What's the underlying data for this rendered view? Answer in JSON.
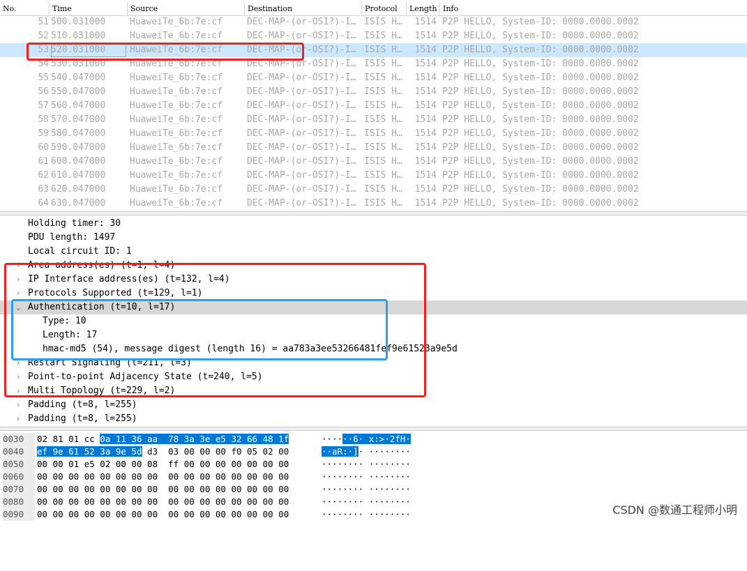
{
  "columns": {
    "no": "No.",
    "time": "Time",
    "source": "Source",
    "destination": "Destination",
    "protocol": "Protocol",
    "length": "Length",
    "info": "Info"
  },
  "packets": [
    {
      "no": "51",
      "time": "500.031000",
      "src": "HuaweiTe_6b:7e:cf",
      "dst": "DEC-MAP-(or-OSI?)-I…",
      "proto": "ISIS H…",
      "len": "1514",
      "info": "P2P HELLO, System-ID: 0000.0000.0002"
    },
    {
      "no": "52",
      "time": "510.031000",
      "src": "HuaweiTe_6b:7e:cf",
      "dst": "DEC-MAP-(or-OSI?)-I…",
      "proto": "ISIS H…",
      "len": "1514",
      "info": "P2P HELLO, System-ID: 0000.0000.0002"
    },
    {
      "no": "53",
      "time": "520.031000",
      "src": "HuaweiTe_6b:7e:cf",
      "dst": "DEC-MAP-(or-OSI?)-I…",
      "proto": "ISIS H…",
      "len": "1514",
      "info": "P2P HELLO, System-ID: 0000.0000.0002"
    },
    {
      "no": "54",
      "time": "530.031000",
      "src": "HuaweiTe_6b:7e:cf",
      "dst": "DEC-MAP-(or-OSI?)-I…",
      "proto": "ISIS H…",
      "len": "1514",
      "info": "P2P HELLO, System-ID: 0000.0000.0002"
    },
    {
      "no": "55",
      "time": "540.047000",
      "src": "HuaweiTe_6b:7e:cf",
      "dst": "DEC-MAP-(or-OSI?)-I…",
      "proto": "ISIS H…",
      "len": "1514",
      "info": "P2P HELLO, System-ID: 0000.0000.0002"
    },
    {
      "no": "56",
      "time": "550.047000",
      "src": "HuaweiTe_6b:7e:cf",
      "dst": "DEC-MAP-(or-OSI?)-I…",
      "proto": "ISIS H…",
      "len": "1514",
      "info": "P2P HELLO, System-ID: 0000.0000.0002"
    },
    {
      "no": "57",
      "time": "560.047000",
      "src": "HuaweiTe_6b:7e:cf",
      "dst": "DEC-MAP-(or-OSI?)-I…",
      "proto": "ISIS H…",
      "len": "1514",
      "info": "P2P HELLO, System-ID: 0000.0000.0002"
    },
    {
      "no": "58",
      "time": "570.047000",
      "src": "HuaweiTe_6b:7e:cf",
      "dst": "DEC-MAP-(or-OSI?)-I…",
      "proto": "ISIS H…",
      "len": "1514",
      "info": "P2P HELLO, System-ID: 0000.0000.0002"
    },
    {
      "no": "59",
      "time": "580.047000",
      "src": "HuaweiTe_6b:7e:cf",
      "dst": "DEC-MAP-(or-OSI?)-I…",
      "proto": "ISIS H…",
      "len": "1514",
      "info": "P2P HELLO, System-ID: 0000.0000.0002"
    },
    {
      "no": "60",
      "time": "590.047000",
      "src": "HuaweiTe_6b:7e:cf",
      "dst": "DEC-MAP-(or-OSI?)-I…",
      "proto": "ISIS H…",
      "len": "1514",
      "info": "P2P HELLO, System-ID: 0000.0000.0002"
    },
    {
      "no": "61",
      "time": "600.047000",
      "src": "HuaweiTe_6b:7e:cf",
      "dst": "DEC-MAP-(or-OSI?)-I…",
      "proto": "ISIS H…",
      "len": "1514",
      "info": "P2P HELLO, System-ID: 0000.0000.0002"
    },
    {
      "no": "62",
      "time": "610.047000",
      "src": "HuaweiTe_6b:7e:cf",
      "dst": "DEC-MAP-(or-OSI?)-I…",
      "proto": "ISIS H…",
      "len": "1514",
      "info": "P2P HELLO, System-ID: 0000.0000.0002"
    },
    {
      "no": "63",
      "time": "620.047000",
      "src": "HuaweiTe_6b:7e:cf",
      "dst": "DEC-MAP-(or-OSI?)-I…",
      "proto": "ISIS H…",
      "len": "1514",
      "info": "P2P HELLO, System-ID: 0000.0000.0002"
    },
    {
      "no": "64",
      "time": "630.047000",
      "src": "HuaweiTe_6b:7e:cf",
      "dst": "DEC-MAP-(or-OSI?)-I…",
      "proto": "ISIS H…",
      "len": "1514",
      "info": "P2P HELLO, System-ID: 0000.0000.0002"
    }
  ],
  "selected_packet": "53",
  "detail": {
    "holding_timer": "Holding timer: 30",
    "pdu_length": "PDU length: 1497",
    "local_circuit": "Local circuit ID: 1",
    "area_address": "Area address(es) (t=1, l=4)",
    "ip_interface": "IP Interface address(es) (t=132, l=4)",
    "protocols_supported": "Protocols Supported (t=129, l=1)",
    "authentication": "Authentication (t=10, l=17)",
    "auth_type": "Type: 10",
    "auth_length": "Length: 17",
    "auth_digest": "hmac-md5 (54), message digest (length 16) = aa783a3ee53266481fef9e61523a9e5d",
    "restart_signaling": "Restart Signaling (t=211, l=3)",
    "p2p_adjacency": "Point-to-point Adjacency State (t=240, l=5)",
    "multi_topology": "Multi Topology (t=229, l=2)",
    "padding_1": "Padding (t=8, l=255)",
    "padding_2": "Padding (t=8, l=255)"
  },
  "hex": {
    "r0": {
      "off": "0030",
      "b1": "02 81 01 cc ",
      "b1s": "0a 11 36 aa  78 3a 3e e5 32 66 48 1f",
      "b2": "",
      "a1": "····",
      "a1s": "··6· x:>·2fH·",
      "a2": ""
    },
    "r1": {
      "off": "0040",
      "b1": "",
      "b1s": "ef 9e 61 52 3a 9e 5d",
      "b2": " d3  03 00 00 00 f0 05 02 00",
      "a1": "",
      "a1s": "··aR:·]",
      "a2": "· ········"
    },
    "r2": {
      "off": "0050",
      "b1": "00 00 01 e5 02 00 00 08  ff 00 00 00 00 00 00 00",
      "b1s": "",
      "b2": "",
      "a1": "········ ········",
      "a1s": "",
      "a2": ""
    },
    "r3": {
      "off": "0060",
      "b1": "00 00 00 00 00 00 00 00  00 00 00 00 00 00 00 00",
      "b1s": "",
      "b2": "",
      "a1": "········ ········",
      "a1s": "",
      "a2": ""
    },
    "r4": {
      "off": "0070",
      "b1": "00 00 00 00 00 00 00 00  00 00 00 00 00 00 00 00",
      "b1s": "",
      "b2": "",
      "a1": "········ ········",
      "a1s": "",
      "a2": ""
    },
    "r5": {
      "off": "0080",
      "b1": "00 00 00 00 00 00 00 00  00 00 00 00 00 00 00 00",
      "b1s": "",
      "b2": "",
      "a1": "········ ········",
      "a1s": "",
      "a2": ""
    },
    "r6": {
      "off": "0090",
      "b1": "00 00 00 00 00 00 00 00  00 00 00 00 00 00 00 00",
      "b1s": "",
      "b2": "",
      "a1": "········ ········",
      "a1s": "",
      "a2": ""
    }
  },
  "watermark": "CSDN @数通工程师小明",
  "colors": {
    "red_box": "#ff1a1a",
    "blue_box": "#2a9df4",
    "selection": "#cce8ff",
    "hex_selection": "#0078d7"
  }
}
